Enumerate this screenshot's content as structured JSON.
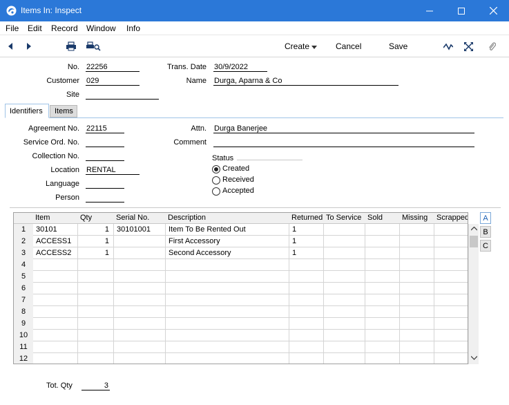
{
  "window": {
    "title": "Items In: Inspect"
  },
  "menu": [
    "File",
    "Edit",
    "Record",
    "Window",
    "Info"
  ],
  "toolbar": {
    "create_label": "Create",
    "cancel_label": "Cancel",
    "save_label": "Save"
  },
  "header": {
    "no_label": "No.",
    "no_value": "22256",
    "trans_date_label": "Trans. Date",
    "trans_date_value": "30/9/2022",
    "customer_label": "Customer",
    "customer_value": "029",
    "name_label": "Name",
    "name_value": "Durga, Aparna & Co",
    "site_label": "Site",
    "site_value": ""
  },
  "tabs": [
    {
      "label": "Identifiers"
    },
    {
      "label": "Items"
    }
  ],
  "identifiers": {
    "agreement_label": "Agreement No.",
    "agreement_value": "22115",
    "service_label": "Service Ord. No.",
    "service_value": "",
    "collection_label": "Collection No.",
    "collection_value": "",
    "location_label": "Location",
    "location_value": "RENTAL",
    "language_label": "Language",
    "language_value": "",
    "person_label": "Person",
    "person_value": "",
    "attn_label": "Attn.",
    "attn_value": "Durga Banerjee",
    "comment_label": "Comment",
    "comment_value": "",
    "status_label": "Status",
    "status_options": [
      "Created",
      "Received",
      "Accepted"
    ],
    "status_selected": "Created"
  },
  "grid": {
    "columns": [
      "Item",
      "Qty",
      "Serial No.",
      "Description",
      "Returned",
      "To Service",
      "Sold",
      "Missing",
      "Scrapped"
    ],
    "rows": [
      {
        "n": "1",
        "item": "30101",
        "qty": "1",
        "serial": "30101001",
        "description": "Item To Be Rented Out",
        "returned": "1"
      },
      {
        "n": "2",
        "item": "ACCESS1",
        "qty": "1",
        "serial": "",
        "description": "First Accessory",
        "returned": "1"
      },
      {
        "n": "3",
        "item": "ACCESS2",
        "qty": "1",
        "serial": "",
        "description": "Second Accessory",
        "returned": "1"
      },
      {
        "n": "4"
      },
      {
        "n": "5"
      },
      {
        "n": "6"
      },
      {
        "n": "7"
      },
      {
        "n": "8"
      },
      {
        "n": "9"
      },
      {
        "n": "10"
      },
      {
        "n": "11"
      },
      {
        "n": "12"
      }
    ],
    "side_tabs": [
      "A",
      "B",
      "C"
    ],
    "side_selected": "A"
  },
  "footer": {
    "tot_qty_label": "Tot. Qty",
    "tot_qty_value": "3"
  }
}
